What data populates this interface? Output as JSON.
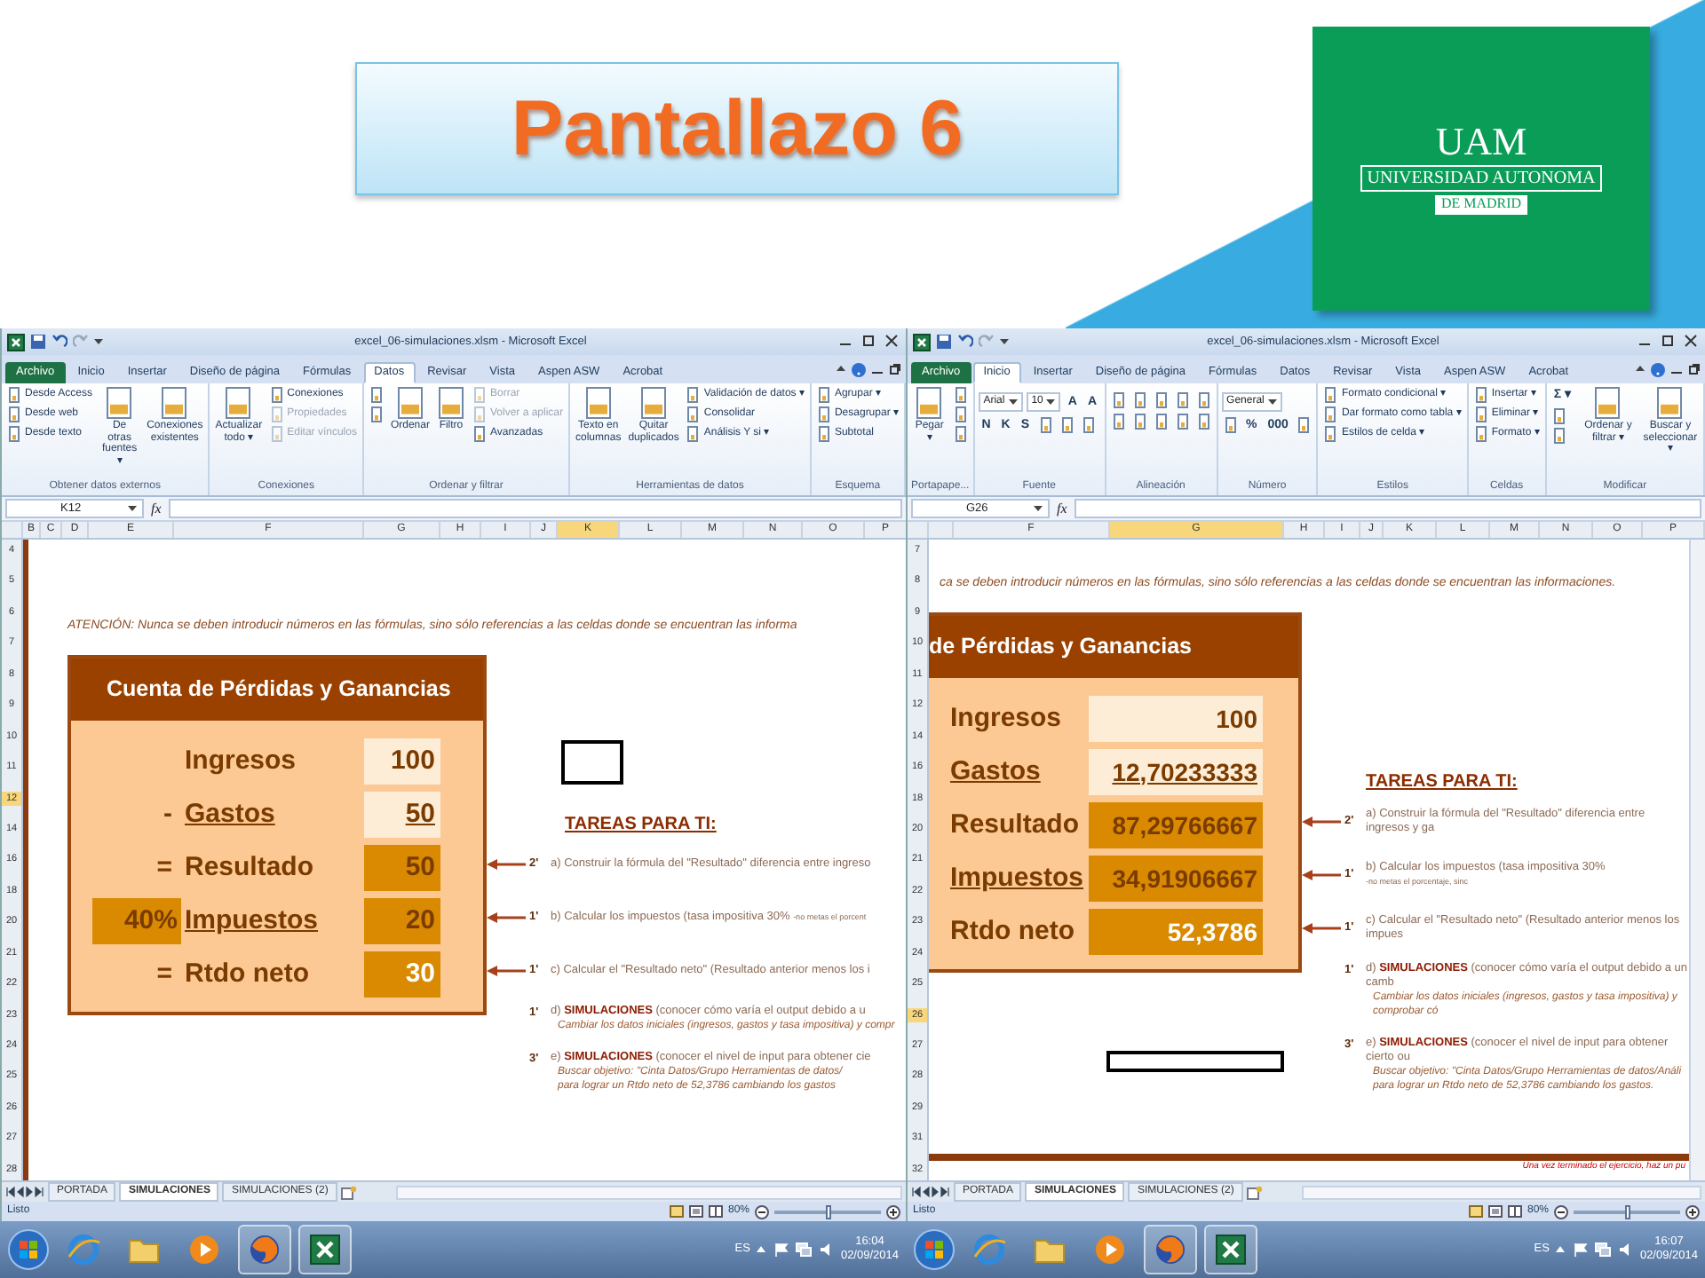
{
  "slide": {
    "title": "Pantallazo 6",
    "logo": {
      "initials": "UAM",
      "name": "UNIVERSIDAD AUTONOMA",
      "city": "DE MADRID"
    }
  },
  "screens": [
    {
      "window": {
        "title": "excel_06-simulaciones.xlsm - Microsoft Excel",
        "tabs": [
          {
            "label": "Archivo",
            "kind": "file",
            "selected": false
          },
          {
            "label": "Inicio",
            "kind": "tab",
            "selected": false
          },
          {
            "label": "Insertar",
            "kind": "tab",
            "selected": false
          },
          {
            "label": "Diseño de página",
            "kind": "tab",
            "selected": false
          },
          {
            "label": "Fórmulas",
            "kind": "tab",
            "selected": false
          },
          {
            "label": "Datos",
            "kind": "tab",
            "selected": true
          },
          {
            "label": "Revisar",
            "kind": "tab",
            "selected": false
          },
          {
            "label": "Vista",
            "kind": "tab",
            "selected": false
          },
          {
            "label": "Aspen ASW",
            "kind": "tab",
            "selected": false
          },
          {
            "label": "Acrobat",
            "kind": "tab",
            "selected": false
          }
        ],
        "ribbon": [
          {
            "label": "Obtener datos externos",
            "kind": "columns",
            "lines": [
              [
                {
                  "kind": "small",
                  "label": "Desde Access",
                  "disabled": false
                },
                {
                  "kind": "small",
                  "label": "Desde web",
                  "disabled": false
                },
                {
                  "kind": "small",
                  "label": "Desde texto",
                  "disabled": false
                }
              ],
              [
                {
                  "kind": "large",
                  "label": "De otras fuentes ▾",
                  "disabled": false
                }
              ],
              [
                {
                  "kind": "large",
                  "label": "Conexiones existentes",
                  "disabled": false
                }
              ]
            ]
          },
          {
            "label": "Conexiones",
            "kind": "columns",
            "lines": [
              [
                {
                  "kind": "large",
                  "label": "Actualizar todo ▾",
                  "disabled": false
                }
              ],
              [
                {
                  "kind": "small",
                  "label": "Conexiones",
                  "disabled": false
                },
                {
                  "kind": "small",
                  "label": "Propiedades",
                  "disabled": true
                },
                {
                  "kind": "small",
                  "label": "Editar vínculos",
                  "disabled": true
                }
              ]
            ]
          },
          {
            "label": "Ordenar y filtrar",
            "kind": "columns",
            "lines": [
              [
                {
                  "kind": "icon",
                  "disabled": false
                },
                {
                  "kind": "icon",
                  "disabled": false
                }
              ],
              [
                {
                  "kind": "large",
                  "label": "Ordenar",
                  "disabled": false
                }
              ],
              [
                {
                  "kind": "large",
                  "label": "Filtro",
                  "disabled": false
                }
              ],
              [
                {
                  "kind": "small",
                  "label": "Borrar",
                  "disabled": true
                },
                {
                  "kind": "small",
                  "label": "Volver a aplicar",
                  "disabled": true
                },
                {
                  "kind": "small",
                  "label": "Avanzadas",
                  "disabled": false
                }
              ]
            ]
          },
          {
            "label": "Herramientas de datos",
            "kind": "columns",
            "lines": [
              [
                {
                  "kind": "large",
                  "label": "Texto en columnas",
                  "disabled": false
                }
              ],
              [
                {
                  "kind": "large",
                  "label": "Quitar duplicados",
                  "disabled": false
                }
              ],
              [
                {
                  "kind": "small",
                  "label": "Validación de datos ▾",
                  "disabled": false
                },
                {
                  "kind": "small",
                  "label": "Consolidar",
                  "disabled": false
                },
                {
                  "kind": "small",
                  "label": "Análisis Y si ▾",
                  "disabled": false
                }
              ]
            ]
          },
          {
            "label": "Esquema",
            "kind": "columns",
            "lines": [
              [
                {
                  "kind": "small",
                  "label": "Agrupar ▾",
                  "disabled": false
                },
                {
                  "kind": "small",
                  "label": "Desagrupar ▾",
                  "disabled": false
                },
                {
                  "kind": "small",
                  "label": "Subtotal",
                  "disabled": false
                }
              ]
            ]
          }
        ],
        "formula_bar": {
          "name_box": "K12",
          "fx": "fx"
        },
        "columns": [
          {
            "label": "B",
            "selected": false
          },
          {
            "label": "C",
            "selected": false
          },
          {
            "label": "D",
            "selected": false
          },
          {
            "label": "E",
            "selected": false
          },
          {
            "label": "F",
            "selected": false
          },
          {
            "label": "G",
            "selected": false
          },
          {
            "label": "H",
            "selected": false
          },
          {
            "label": "I",
            "selected": false
          },
          {
            "label": "J",
            "selected": false
          },
          {
            "label": "K",
            "selected": true
          },
          {
            "label": "L",
            "selected": false
          },
          {
            "label": "M",
            "selected": false
          },
          {
            "label": "N",
            "selected": false
          },
          {
            "label": "O",
            "selected": false
          },
          {
            "label": "P",
            "selected": false
          }
        ],
        "rows": [
          {
            "label": "4",
            "selected": false
          },
          {
            "label": "5",
            "selected": false
          },
          {
            "label": "6",
            "selected": false
          },
          {
            "label": "7",
            "selected": false
          },
          {
            "label": "8",
            "selected": false
          },
          {
            "label": "9",
            "selected": false
          },
          {
            "label": "10",
            "selected": false
          },
          {
            "label": "11",
            "selected": false
          },
          {
            "label": "12",
            "selected": true
          },
          {
            "label": "14",
            "selected": false
          },
          {
            "label": "16",
            "selected": false
          },
          {
            "label": "18",
            "selected": false
          },
          {
            "label": "20",
            "selected": false
          },
          {
            "label": "21",
            "selected": false
          },
          {
            "label": "22",
            "selected": false
          },
          {
            "label": "23",
            "selected": false
          },
          {
            "label": "24",
            "selected": false
          },
          {
            "label": "25",
            "selected": false
          },
          {
            "label": "26",
            "selected": false
          },
          {
            "label": "27",
            "selected": false
          },
          {
            "label": "28",
            "selected": false
          }
        ],
        "notice": "ATENCIÓN: Nunca se deben introducir números en las fórmulas, sino sólo referencias a las celdas donde se encuentran las informa",
        "statement": {
          "title": "Cuenta de Pérdidas y Ganancias",
          "lines": [
            {
              "label": "Ingresos",
              "value": "100",
              "kind": "input",
              "label_underlined": false,
              "value_underlined": false
            },
            {
              "sign": "-",
              "label": "Gastos",
              "value": "50",
              "kind": "input",
              "label_underlined": true,
              "value_underlined": true
            },
            {
              "sign": "=",
              "label": "Resultado",
              "value": "50",
              "kind": "output",
              "label_underlined": false,
              "value_underlined": false
            },
            {
              "rate": "40%",
              "label": "Impuestos",
              "value": "20",
              "kind": "output",
              "label_underlined": true,
              "value_underlined": false
            },
            {
              "sign": "=",
              "label": "Rtdo neto",
              "value": "30",
              "kind": "final",
              "label_underlined": false,
              "value_underlined": false
            }
          ]
        },
        "tasks_heading": "TAREAS PARA TI:",
        "tasks": [
          {
            "time": "2'",
            "text": "a) Construir la fórmula del \"Resultado\" diferencia entre ingreso",
            "arrow": true
          },
          {
            "time": "1'",
            "text": "b) Calcular los impuestos (tasa impositiva 30%",
            "note": "-no metas el porcent",
            "arrow": true
          },
          {
            "time": "1'",
            "text": "c) Calcular el \"Resultado neto\" (Resultado anterior menos los i",
            "arrow": true
          },
          {
            "time": "1'",
            "text": "d) **SIMULACIONES** (conocer cómo varía el output debido a u",
            "details": [
              "Cambiar los datos iniciales (ingresos, gastos y tasa impositiva) y compr"
            ],
            "arrow": false
          },
          {
            "time": "3'",
            "text": "e) **SIMULACIONES** (conocer el nivel de input para obtener cie",
            "details": [
              "Buscar objetivo: \"Cinta Datos/Grupo Herramientas de datos/",
              "para lograr un Rtdo neto de 52,3786 cambiando los gastos"
            ],
            "arrow": false
          }
        ],
        "sheet_tabs": [
          {
            "label": "PORTADA",
            "selected": false
          },
          {
            "label": "SIMULACIONES",
            "selected": true
          },
          {
            "label": "SIMULACIONES (2)",
            "selected": false
          }
        ],
        "status": {
          "text": "Listo",
          "zoom": "80%",
          "level": 0.5
        }
      },
      "taskbar": {
        "apps": [
          {
            "kind": "browser",
            "running": false
          },
          {
            "kind": "folder",
            "running": false
          },
          {
            "kind": "media",
            "running": false
          },
          {
            "kind": "firefox",
            "running": true
          },
          {
            "kind": "excel",
            "running": true
          }
        ],
        "language": "ES",
        "time": "16:04",
        "date": "02/09/2014"
      }
    },
    {
      "window": {
        "title": "excel_06-simulaciones.xlsm - Microsoft Excel",
        "tabs": [
          {
            "label": "Archivo",
            "kind": "file",
            "selected": false
          },
          {
            "label": "Inicio",
            "kind": "tab",
            "selected": true
          },
          {
            "label": "Insertar",
            "kind": "tab",
            "selected": false
          },
          {
            "label": "Diseño de página",
            "kind": "tab",
            "selected": false
          },
          {
            "label": "Fórmulas",
            "kind": "tab",
            "selected": false
          },
          {
            "label": "Datos",
            "kind": "tab",
            "selected": false
          },
          {
            "label": "Revisar",
            "kind": "tab",
            "selected": false
          },
          {
            "label": "Vista",
            "kind": "tab",
            "selected": false
          },
          {
            "label": "Aspen ASW",
            "kind": "tab",
            "selected": false
          },
          {
            "label": "Acrobat",
            "kind": "tab",
            "selected": false
          }
        ],
        "ribbon": [
          {
            "label": "Portapape...",
            "kind": "columns",
            "lines": [
              [
                {
                  "kind": "large",
                  "label": "Pegar ▾",
                  "disabled": false
                }
              ],
              [
                {
                  "kind": "icon",
                  "disabled": false
                },
                {
                  "kind": "icon",
                  "disabled": false
                },
                {
                  "kind": "icon",
                  "disabled": false
                }
              ]
            ]
          },
          {
            "label": "Fuente",
            "kind": "rows",
            "lines": [
              [
                {
                  "kind": "field",
                  "label": "Arial",
                  "disabled": false
                },
                {
                  "kind": "field",
                  "label": "10",
                  "disabled": false
                },
                {
                  "kind": "glyph",
                  "label": "A",
                  "disabled": false
                },
                {
                  "kind": "glyph",
                  "label": "A",
                  "disabled": false
                }
              ],
              [
                {
                  "kind": "glyph",
                  "label": "N",
                  "disabled": false
                },
                {
                  "kind": "glyph",
                  "label": "K",
                  "disabled": false
                },
                {
                  "kind": "glyph",
                  "label": "S",
                  "disabled": false
                },
                {
                  "kind": "icon",
                  "disabled": false
                },
                {
                  "kind": "icon",
                  "disabled": false
                },
                {
                  "kind": "icon",
                  "disabled": false
                }
              ]
            ]
          },
          {
            "label": "Alineación",
            "kind": "rows",
            "lines": [
              [
                {
                  "kind": "icon",
                  "disabled": false
                },
                {
                  "kind": "icon",
                  "disabled": false
                },
                {
                  "kind": "icon",
                  "disabled": false
                },
                {
                  "kind": "icon",
                  "disabled": false
                },
                {
                  "kind": "icon",
                  "disabled": false
                }
              ],
              [
                {
                  "kind": "icon",
                  "disabled": false
                },
                {
                  "kind": "icon",
                  "disabled": false
                },
                {
                  "kind": "icon",
                  "disabled": false
                },
                {
                  "kind": "icon",
                  "disabled": false
                },
                {
                  "kind": "icon",
                  "disabled": false
                }
              ]
            ]
          },
          {
            "label": "Número",
            "kind": "rows",
            "lines": [
              [
                {
                  "kind": "field",
                  "label": "General",
                  "disabled": false
                }
              ],
              [
                {
                  "kind": "icon",
                  "disabled": false
                },
                {
                  "kind": "glyph",
                  "label": "%",
                  "disabled": false
                },
                {
                  "kind": "glyph",
                  "label": "000",
                  "disabled": false
                },
                {
                  "kind": "icon",
                  "disabled": false
                }
              ]
            ]
          },
          {
            "label": "Estilos",
            "kind": "columns",
            "lines": [
              [
                {
                  "kind": "small",
                  "label": "Formato condicional ▾",
                  "disabled": false
                },
                {
                  "kind": "small",
                  "label": "Dar formato como tabla ▾",
                  "disabled": false
                },
                {
                  "kind": "small",
                  "label": "Estilos de celda ▾",
                  "disabled": false
                }
              ]
            ]
          },
          {
            "label": "Celdas",
            "kind": "columns",
            "lines": [
              [
                {
                  "kind": "small",
                  "label": "Insertar ▾",
                  "disabled": false
                },
                {
                  "kind": "small",
                  "label": "Eliminar ▾",
                  "disabled": false
                },
                {
                  "kind": "small",
                  "label": "Formato ▾",
                  "disabled": false
                }
              ]
            ]
          },
          {
            "label": "Modificar",
            "kind": "columns",
            "lines": [
              [
                {
                  "kind": "glyph",
                  "label": "Σ ▾",
                  "disabled": false
                },
                {
                  "kind": "icon",
                  "disabled": false
                },
                {
                  "kind": "icon",
                  "disabled": false
                }
              ],
              [
                {
                  "kind": "large",
                  "label": "Ordenar y filtrar ▾",
                  "disabled": false
                }
              ],
              [
                {
                  "kind": "large",
                  "label": "Buscar y seleccionar ▾",
                  "disabled": false
                }
              ]
            ]
          }
        ],
        "formula_bar": {
          "name_box": "G26",
          "fx": "fx"
        },
        "columns": [
          {
            "label": "F",
            "selected": false
          },
          {
            "label": "G",
            "selected": true
          },
          {
            "label": "H",
            "selected": false
          },
          {
            "label": "I",
            "selected": false
          },
          {
            "label": "J",
            "selected": false
          },
          {
            "label": "K",
            "selected": false
          },
          {
            "label": "L",
            "selected": false
          },
          {
            "label": "M",
            "selected": false
          },
          {
            "label": "N",
            "selected": false
          },
          {
            "label": "O",
            "selected": false
          },
          {
            "label": "P",
            "selected": false
          }
        ],
        "rows": [
          {
            "label": "7",
            "selected": false
          },
          {
            "label": "8",
            "selected": false
          },
          {
            "label": "9",
            "selected": false
          },
          {
            "label": "10",
            "selected": false
          },
          {
            "label": "11",
            "selected": false
          },
          {
            "label": "12",
            "selected": false
          },
          {
            "label": "14",
            "selected": false
          },
          {
            "label": "16",
            "selected": false
          },
          {
            "label": "18",
            "selected": false
          },
          {
            "label": "20",
            "selected": false
          },
          {
            "label": "21",
            "selected": false
          },
          {
            "label": "22",
            "selected": false
          },
          {
            "label": "23",
            "selected": false
          },
          {
            "label": "24",
            "selected": false
          },
          {
            "label": "25",
            "selected": false
          },
          {
            "label": "26",
            "selected": true
          },
          {
            "label": "27",
            "selected": false
          },
          {
            "label": "28",
            "selected": false
          },
          {
            "label": "29",
            "selected": false
          },
          {
            "label": "31",
            "selected": false
          },
          {
            "label": "32",
            "selected": false
          }
        ],
        "notice": "ca se deben introducir números en las fórmulas, sino sólo referencias a las celdas donde se encuentran las informaciones.",
        "statement": {
          "title": "de Pérdidas y Ganancias",
          "lines": [
            {
              "label": "Ingresos",
              "value": "100",
              "kind": "input",
              "label_underlined": false,
              "value_underlined": false
            },
            {
              "label": "Gastos",
              "value": "12,70233333",
              "kind": "input",
              "label_underlined": true,
              "value_underlined": true
            },
            {
              "label": "Resultado",
              "value": "87,29766667",
              "kind": "output",
              "label_underlined": false,
              "value_underlined": false
            },
            {
              "label": "Impuestos",
              "value": "34,91906667",
              "kind": "output",
              "label_underlined": true,
              "value_underlined": false
            },
            {
              "label": "Rtdo neto",
              "value": "52,3786",
              "kind": "final",
              "label_underlined": false,
              "value_underlined": false
            }
          ]
        },
        "tasks_heading": "TAREAS PARA TI:",
        "tasks": [
          {
            "time": "2'",
            "text": "a) Construir la fórmula del \"Resultado\" diferencia entre ingresos y ga",
            "arrow": true
          },
          {
            "time": "1'",
            "text": "b) Calcular los impuestos (tasa impositiva 30%",
            "note": "-no metas el porcentaje, sinc",
            "arrow": true
          },
          {
            "time": "1'",
            "text": "c) Calcular el \"Resultado neto\" (Resultado anterior menos los impues",
            "arrow": true
          },
          {
            "time": "1'",
            "text": "d) **SIMULACIONES** (conocer cómo varía el output debido a un camb",
            "details": [
              "Cambiar los datos iniciales (ingresos, gastos y tasa impositiva) y comprobar có"
            ],
            "arrow": false
          },
          {
            "time": "3'",
            "text": "e) **SIMULACIONES** (conocer el nivel de input para obtener cierto ou",
            "details": [
              "Buscar objetivo: \"Cinta Datos/Grupo Herramientas de datos/Análi",
              "para lograr un Rtdo neto de 52,3786 cambiando los gastos."
            ],
            "arrow": false
          }
        ],
        "footer_note": "Una vez terminado el ejercicio, haz un pu",
        "sheet_tabs": [
          {
            "label": "PORTADA",
            "selected": false
          },
          {
            "label": "SIMULACIONES",
            "selected": true
          },
          {
            "label": "SIMULACIONES (2)",
            "selected": false
          }
        ],
        "status": {
          "text": "Listo",
          "zoom": "80%",
          "level": 0.5
        }
      },
      "taskbar": {
        "apps": [
          {
            "kind": "browser",
            "running": false
          },
          {
            "kind": "folder",
            "running": false
          },
          {
            "kind": "media",
            "running": false
          },
          {
            "kind": "firefox",
            "running": true
          },
          {
            "kind": "excel",
            "running": true
          }
        ],
        "language": "ES",
        "time": "16:07",
        "date": "02/09/2014"
      }
    }
  ]
}
